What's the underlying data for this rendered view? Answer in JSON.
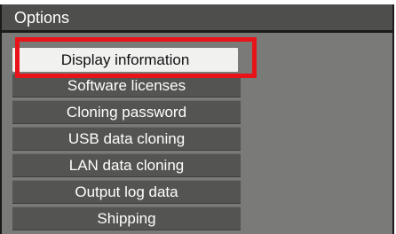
{
  "window": {
    "title": "Options"
  },
  "menu": {
    "items": [
      {
        "label": "Display information",
        "selected": true
      },
      {
        "label": "Software licenses",
        "selected": false
      },
      {
        "label": "Cloning password",
        "selected": false
      },
      {
        "label": "USB data cloning",
        "selected": false
      },
      {
        "label": "LAN data cloning",
        "selected": false
      },
      {
        "label": "Output log data",
        "selected": false
      },
      {
        "label": "Shipping",
        "selected": false
      }
    ]
  },
  "colors": {
    "window_background": "#7a7a78",
    "titlebar_background": "#4e4e4c",
    "menu_item_background": "#545452",
    "selected_item_background": "#f1f1f0",
    "highlight_frame": "#e8141a"
  }
}
